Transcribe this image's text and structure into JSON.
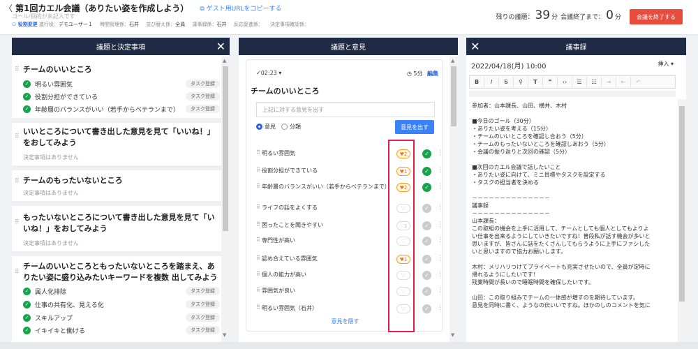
{
  "header": {
    "back_icon": "chevron-left-icon",
    "title": "第1回カエル会議（ありたい姿を作成しよう）",
    "guest_link": "ゲスト用URLをコピーする",
    "goal_placeholder": "ゴール/目的が未記入です",
    "roles": [
      {
        "key": "役割変更",
        "type": "link"
      },
      {
        "key": "進行役：",
        "value": "デモユーザー１"
      },
      {
        "key": "時間管理係：",
        "value": "石井"
      },
      {
        "key": "並び替え係：",
        "value": "全員"
      },
      {
        "key": "議事録係：",
        "value": "石井"
      },
      {
        "key": "反応促進係：",
        "value": ""
      },
      {
        "key": "決定事項確認係：",
        "value": ""
      }
    ],
    "remaining_label": "残りの議題：",
    "remaining_value": "39",
    "remaining_unit": "分",
    "end_label": "会議終了まで：",
    "end_value": "0",
    "end_unit": "分",
    "end_button": "会議を終了する",
    "end_button_color": "#e74c3c"
  },
  "panel_agenda": {
    "title": "議題と決定事項",
    "sections": [
      {
        "title": "チームのいいところ",
        "decisions": [
          {
            "label": "明るい雰囲気",
            "task": "タスク登録"
          },
          {
            "label": "役割分担ができている",
            "task": "タスク登録"
          },
          {
            "label": "年齢層のバランスがいい（若手からベテランまで）",
            "task": "タスク登録"
          }
        ]
      },
      {
        "title_lines": [
          "いいところについて書き出した意見を見て「いいね！」",
          "をおしてみよう"
        ],
        "no_decisions": "決定事項はありません"
      },
      {
        "title": "チームのもったいないところ",
        "no_decisions": "決定事項はありません"
      },
      {
        "title_lines": [
          "もったいないところについて書き出した意見を見て「い",
          "いね！」をおしてみよう"
        ],
        "no_decisions": "決定事項はありません"
      },
      {
        "title_lines": [
          "チームのいいところともったいないところを踏まえ、あ",
          "りたい姿に盛り込みたいキーワードを複数 出してみよう"
        ],
        "decisions": [
          {
            "label": "属人化排除",
            "task": "タスク登録"
          },
          {
            "label": "仕事の共有化、見える化",
            "task": "タスク登録"
          },
          {
            "label": "スキルアップ",
            "task": "タスク登録"
          },
          {
            "label": "イキイキと働ける",
            "task": "タスク登録"
          }
        ]
      }
    ]
  },
  "panel_opinions": {
    "title": "議題と意見",
    "time": "02:23",
    "timer": "5分",
    "edit": "編集",
    "card_title": "チームのいいところ",
    "input_placeholder": "上記に対する意見を出す",
    "radio_opinion": "意見",
    "radio_category": "分類",
    "submit": "意見を出す",
    "opinions": [
      {
        "text": "明るい雰囲気",
        "likes": "2",
        "liked": true,
        "done": true
      },
      {
        "text": "役割分担ができている",
        "likes": "1",
        "liked": true,
        "done": true
      },
      {
        "text": "年齢層のバランスがいい（若手からベテランまで）",
        "likes": "2",
        "liked": true,
        "done": true
      },
      {
        "text": "ライフの話をよくする",
        "likes": "",
        "liked": false,
        "done": false
      },
      {
        "text": "困ったことを聞きやすい",
        "likes": "1",
        "liked": false,
        "done": false
      },
      {
        "text": "専門性が高い",
        "likes": "",
        "liked": false,
        "done": false
      },
      {
        "text": "認め合えている雰囲気",
        "likes": "1",
        "liked": true,
        "done": false
      },
      {
        "text": "個人の能力が高い",
        "likes": "",
        "liked": false,
        "done": false
      },
      {
        "text": "雰囲気が良い",
        "likes": "",
        "liked": false,
        "done": false
      },
      {
        "text": "明るい雰囲気（石井）",
        "likes": "",
        "liked": false,
        "done": false
      }
    ],
    "hide_link": "意見を隠す"
  },
  "panel_minutes": {
    "title": "議事録",
    "date": "2022/04/18(月) 10:00",
    "insert": "挿入",
    "toolbar": [
      "B",
      "I",
      "S",
      "link",
      "T",
      "quote",
      "code",
      "ul",
      "ol",
      "indent",
      "outdent",
      "undo"
    ],
    "lines": [
      "参加者：山本課長、山田、横井、木村",
      "",
      "■今日のゴール（30分）",
      "・ありたい姿を考える（15分）",
      "・チームのいいところを確認し合おう（5分）",
      "・チームのもったいないところを確認しあおう（5分）",
      "・会議の振り返りと次回の確認（5分）",
      "",
      "■次回のカエル会議で話したいこと",
      "・ありたい姿に向けて、ミニ目標やタスクを設定する",
      "・タスクの担当者を決める",
      "",
      "－－－－－－－－－－－－－－",
      "議事録",
      "－－－－－－－－－－－－－－",
      "山本課長：",
      "この取組の機会を上手に活用して、チームとしても個人としてもよりよ",
      "い仕事を出来るようにしていきたいですね！普段私が話す機会が多いと",
      "思いますが、皆さんに話をたくさんしてもらうように上手にファシした",
      "いと思いますので協力お願いします。",
      "",
      "木村：メリハリつけてプライベートも充実させたいので、全員が定時に",
      "帰れるようにしたいです！",
      "残業時間が長いので睡眠時間を確保したいです。",
      "",
      "山田：この取り組みでチームの一体感が増すのを期待しています。",
      "意見を同時に書く、ようなの伝いいですね。ほかのしのコメントを気に"
    ]
  }
}
